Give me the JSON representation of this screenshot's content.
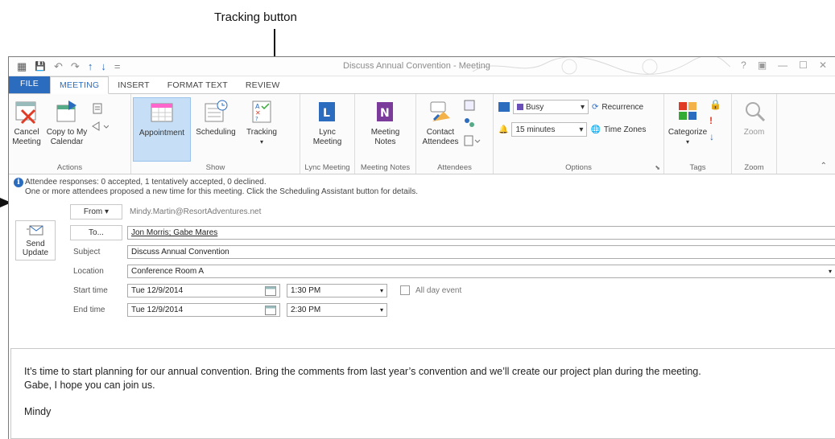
{
  "callout": {
    "label": "Tracking button"
  },
  "window": {
    "title": "Discuss Annual Convention - Meeting",
    "controls": [
      "?",
      "▣",
      "—",
      "☐",
      "✕"
    ],
    "qat": [
      "▦",
      "💾",
      "↶",
      "↷",
      "↑",
      "↓",
      "="
    ]
  },
  "tabs": [
    "FILE",
    "MEETING",
    "INSERT",
    "FORMAT TEXT",
    "REVIEW"
  ],
  "ribbon": {
    "actions": {
      "label": "Actions",
      "cancel": "Cancel\nMeeting",
      "copy": "Copy to My\nCalendar"
    },
    "show": {
      "label": "Show",
      "appointment": "Appointment",
      "scheduling": "Scheduling",
      "tracking": "Tracking"
    },
    "lync": {
      "label": "Lync Meeting",
      "button": "Lync\nMeeting"
    },
    "notes": {
      "label": "Meeting Notes",
      "button": "Meeting\nNotes"
    },
    "attendees": {
      "label": "Attendees",
      "button": "Contact\nAttendees"
    },
    "options": {
      "label": "Options",
      "show_as": "Busy",
      "reminder": "15 minutes",
      "recurrence": "Recurrence",
      "time_zones": "Time Zones"
    },
    "tags": {
      "label": "Tags",
      "categorize": "Categorize"
    },
    "zoom": {
      "label": "Zoom",
      "button": "Zoom"
    }
  },
  "info": {
    "line1": "Attendee responses: 0 accepted, 1 tentatively accepted, 0 declined.",
    "line2": "One or more attendees proposed a new time for this meeting. Click the Scheduling Assistant button for details."
  },
  "form": {
    "send": "Send\nUpdate",
    "from_btn": "From ▾",
    "from_value": "Mindy.Martin@ResortAdventures.net",
    "to_btn": "To...",
    "to_value": "Jon Morris; Gabe Mares",
    "subject_label": "Subject",
    "subject_value": "Discuss Annual Convention",
    "location_label": "Location",
    "location_value": "Conference Room A",
    "start_label": "Start time",
    "start_date": "Tue 12/9/2014",
    "start_time": "1:30 PM",
    "all_day": "All day event",
    "end_label": "End time",
    "end_date": "Tue 12/9/2014",
    "end_time": "2:30 PM"
  },
  "body": {
    "para1": "It’s time to start planning for our annual convention. Bring the comments from last year’s convention and we’ll create our project plan during the meeting.",
    "para2": "Gabe, I hope you can join us.",
    "sign": "Mindy"
  },
  "colors": {
    "accent": "#2b6cbf",
    "selected": "#c7dff6"
  }
}
